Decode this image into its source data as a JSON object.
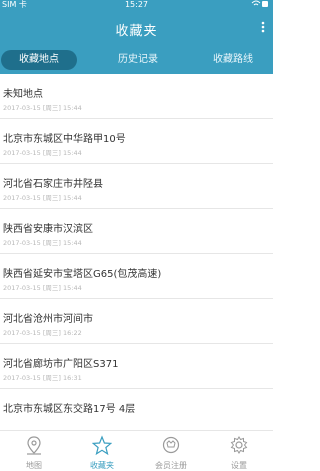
{
  "status_bar": {
    "carrier": "SIM 卡",
    "time": "15:27",
    "icons": "wifi-battery"
  },
  "header": {
    "title": "收藏夹",
    "more_icon": "more-icon"
  },
  "tabs": [
    {
      "label": "收藏地点",
      "active": true
    },
    {
      "label": "历史记录",
      "active": false
    },
    {
      "label": "收藏路线",
      "active": false
    }
  ],
  "items": [
    {
      "name": "未知地点",
      "date": "2017-03-15 [周三] 15:44"
    },
    {
      "name": "北京市东城区中华路甲10号",
      "date": "2017-03-15 [周三] 15:44"
    },
    {
      "name": "河北省石家庄市井陉县",
      "date": "2017-03-15 [周三] 15:44"
    },
    {
      "name": "陕西省安康市汉滨区",
      "date": "2017-03-15 [周三] 15:44"
    },
    {
      "name": "陕西省延安市宝塔区G65(包茂高速)",
      "date": "2017-03-15 [周三] 15:44"
    },
    {
      "name": "河北省沧州市河间市",
      "date": "2017-03-15 [周三] 16:22"
    },
    {
      "name": "河北省廊坊市广阳区S371",
      "date": "2017-03-15 [周三] 16:31"
    },
    {
      "name": "北京市东城区东交路17号 4层",
      "date": ""
    }
  ],
  "tabbar": [
    {
      "label": "地图",
      "icon": "map-pin-icon",
      "active": false
    },
    {
      "label": "收藏夹",
      "icon": "star-icon",
      "active": true
    },
    {
      "label": "会员注册",
      "icon": "member-icon",
      "active": false
    },
    {
      "label": "设置",
      "icon": "gear-icon",
      "active": false
    }
  ],
  "colors": {
    "primary": "#3a9ec0",
    "active_tab_bg": "#1f6f8c"
  }
}
